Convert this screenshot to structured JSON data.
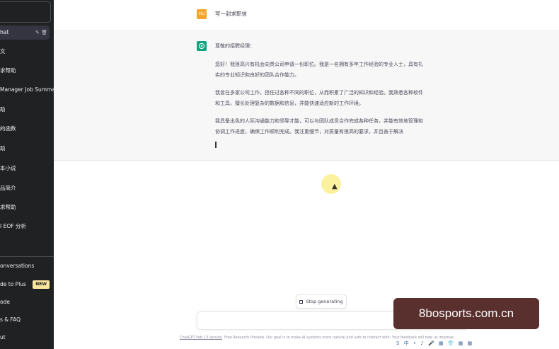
{
  "sidebar": {
    "items": [
      {
        "label": "hat"
      },
      {
        "label": "文"
      },
      {
        "label": "求帮助"
      },
      {
        "label": "Manager Job Summar"
      },
      {
        "label": "助"
      },
      {
        "label": "的函数"
      },
      {
        "label": "助"
      },
      {
        "label": "本小说"
      },
      {
        "label": "品简介"
      },
      {
        "label": "求帮助"
      },
      {
        "label": "I EOF 分析"
      }
    ],
    "bottom": [
      {
        "label": "onversations"
      },
      {
        "label": "de to Plus",
        "badge": "NEW"
      },
      {
        "label": "ode"
      },
      {
        "label": "s & FAQ"
      },
      {
        "label": "ut"
      }
    ],
    "active_icons": "✎ 🗑"
  },
  "conversation": {
    "user": {
      "avatar": "HU",
      "text": "写一封求职信"
    },
    "assistant": {
      "greeting": "尊敬的招聘经理：",
      "paragraphs": [
        "您好！我很高兴有机会向贵公司申请一份职位。我是一名拥有多年工作经验的专业人士，具有扎实的专业知识和良好的团队合作能力。",
        "我曾在多家公司工作，担任过各种不同的职位，从而积累了广泛的知识和经验。我熟悉各种软件和工具，擅长处理复杂的数据和信息，并能快速适应新的工作环境。",
        "我具备出色的人际沟通能力和领导才能，可以与团队成员合作完成各种任务，并能有效地管理和协调工作进度，确保工作顺利完成。我注重细节，对质量有很高的要求，并且善于解决"
      ]
    }
  },
  "controls": {
    "stop_label": "Stop generating",
    "footer_link": "ChatGPT Feb 13 Version",
    "footer_text": ". Free Research Preview. Our goal is to make AI systems more natural and safe to interact with. Your feedback will help us improve."
  },
  "watermark": "8bosports.com.cn",
  "tray": [
    "S",
    "中",
    "•",
    "♪",
    "🎤",
    "▦",
    "👕",
    "▦",
    "▦"
  ],
  "colors": {
    "sidebar": "#202123",
    "assistant_bg": "#f7f7f8",
    "bot_avatar": "#10a37f",
    "user_avatar": "#f4a52c",
    "badge": "#fae69e",
    "watermark_bg": "#59302d"
  }
}
